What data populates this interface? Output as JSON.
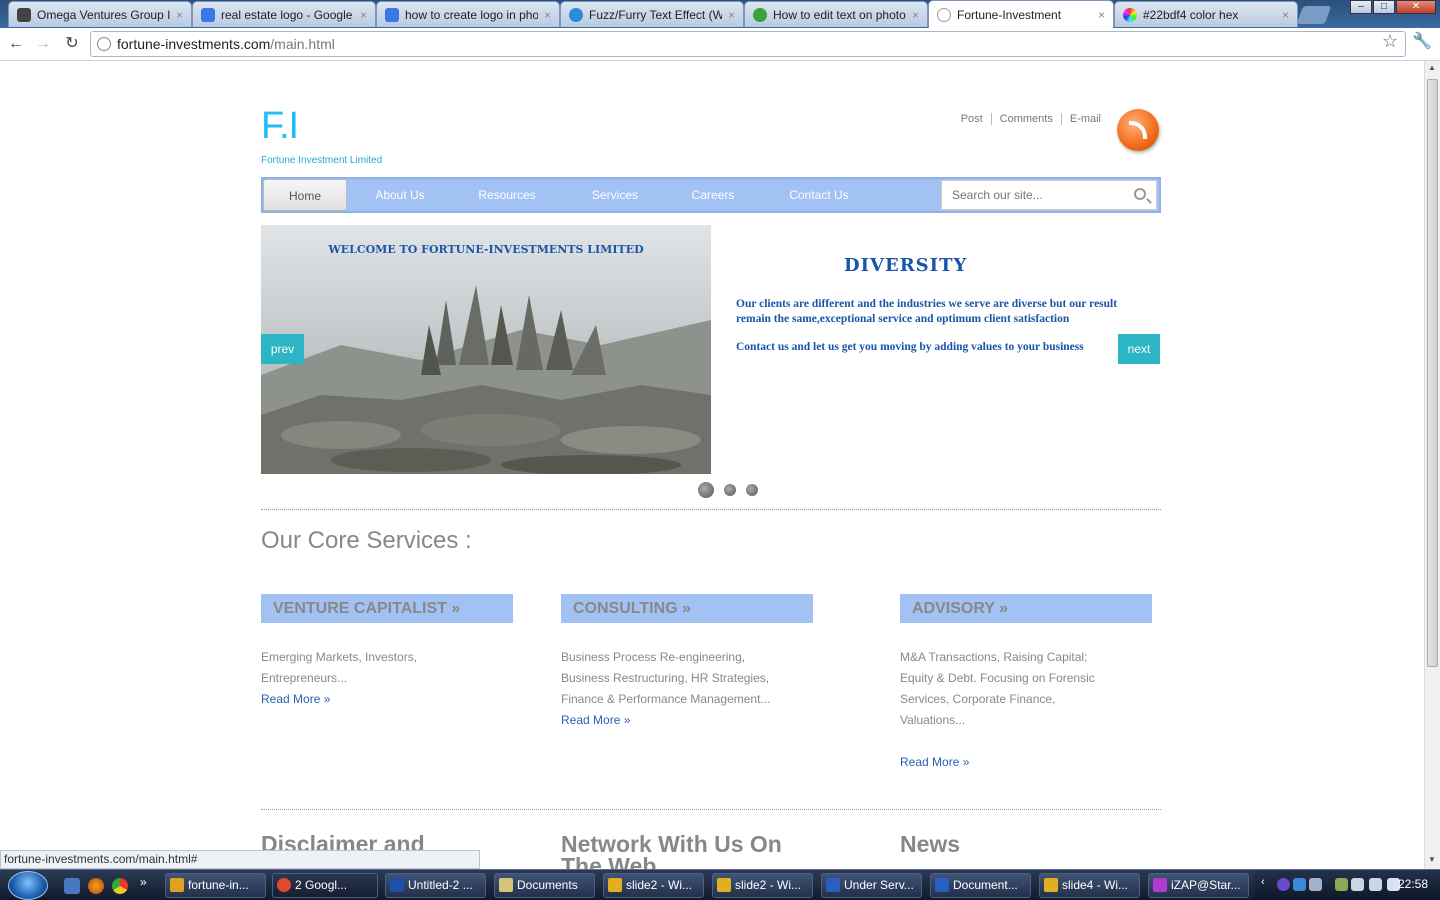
{
  "browser": {
    "tabs": [
      {
        "title": "Omega Ventures Group Ir",
        "color": "#444444"
      },
      {
        "title": "real estate logo - Google S",
        "color": "#3a78e8"
      },
      {
        "title": "how to create logo in pho",
        "color": "#3a78e8"
      },
      {
        "title": "Fuzz/Furry Text Effect (Wo",
        "color": "#2a8bd8"
      },
      {
        "title": "How to edit text on photo",
        "color": "#3aa33a"
      },
      {
        "title": "Fortune-Investment",
        "color": "#aaaaaa"
      },
      {
        "title": "#22bdf4 color hex",
        "color": "#c83aa0"
      }
    ],
    "close_glyph": "×",
    "url_domain": "fortune-investments.com",
    "url_path": "/main.html",
    "status_text": "fortune-investments.com/main.html#"
  },
  "site": {
    "logo": "F.I",
    "tagline": "Fortune Investment Limited",
    "top_links": [
      "Post",
      "Comments",
      "E-mail"
    ],
    "nav": [
      "Home",
      "About Us",
      "Resources",
      "Services",
      "Careers",
      "Contact Us"
    ],
    "search_placeholder": "Search our site...",
    "accent_color": "#22bdf4",
    "nav_color": "#a2c2f4"
  },
  "slider": {
    "welcome": "WELCOME TO FORTUNE-INVESTMENTS LIMITED",
    "heading": "DIVERSITY",
    "paragraph1": "Our clients are different and the industries we serve are diverse but our  result remain the same,exceptional service and optimum client satisfaction",
    "paragraph2": "Contact us and let us get you moving by adding values  to your business",
    "prev_label": "prev",
    "next_label": "next",
    "active_slide": 1,
    "slide_count": 3
  },
  "core": {
    "title": "Our Core Services :",
    "services": [
      {
        "heading": "VENTURE CAPITALIST »",
        "lines": [
          "Emerging Markets, Investors,",
          "Entrepreneurs..."
        ],
        "read_more": "Read More »"
      },
      {
        "heading": "CONSULTING  »",
        "lines": [
          "Business Process Re-engineering,",
          "Business Restructuring, HR Strategies,",
          "Finance & Performance Management..."
        ],
        "read_more": "Read More »"
      },
      {
        "heading": "ADVISORY  »",
        "lines": [
          "M&A Transactions, Raising Capital;",
          "Equity & Debt. Focusing on Forensic",
          "Services, Corporate Finance,",
          "Valuations..."
        ],
        "read_more": "Read More »"
      }
    ]
  },
  "footer": {
    "headings": [
      "Disclaimer and",
      "Network With Us On The Web",
      "News"
    ]
  },
  "taskbar": {
    "buttons": [
      {
        "label": "fortune-in...",
        "icon_color": "#e0a020"
      },
      {
        "label": "2 Googl...",
        "icon_color": "#e04a2a"
      },
      {
        "label": "Untitled-2 ...",
        "icon_color": "#1f4fa8"
      },
      {
        "label": "Documents",
        "icon_color": "#d8c37a"
      },
      {
        "label": "slide2 - Wi...",
        "icon_color": "#e0b020"
      },
      {
        "label": "slide2 - Wi...",
        "icon_color": "#e0b020"
      },
      {
        "label": "Under Serv...",
        "icon_color": "#2b5fbf"
      },
      {
        "label": "Document...",
        "icon_color": "#2b5fbf"
      },
      {
        "label": "slide4 - Wi...",
        "icon_color": "#e0b020"
      },
      {
        "label": "iZAP@Star...",
        "icon_color": "#b03ad0"
      }
    ],
    "clock": "22:58"
  }
}
